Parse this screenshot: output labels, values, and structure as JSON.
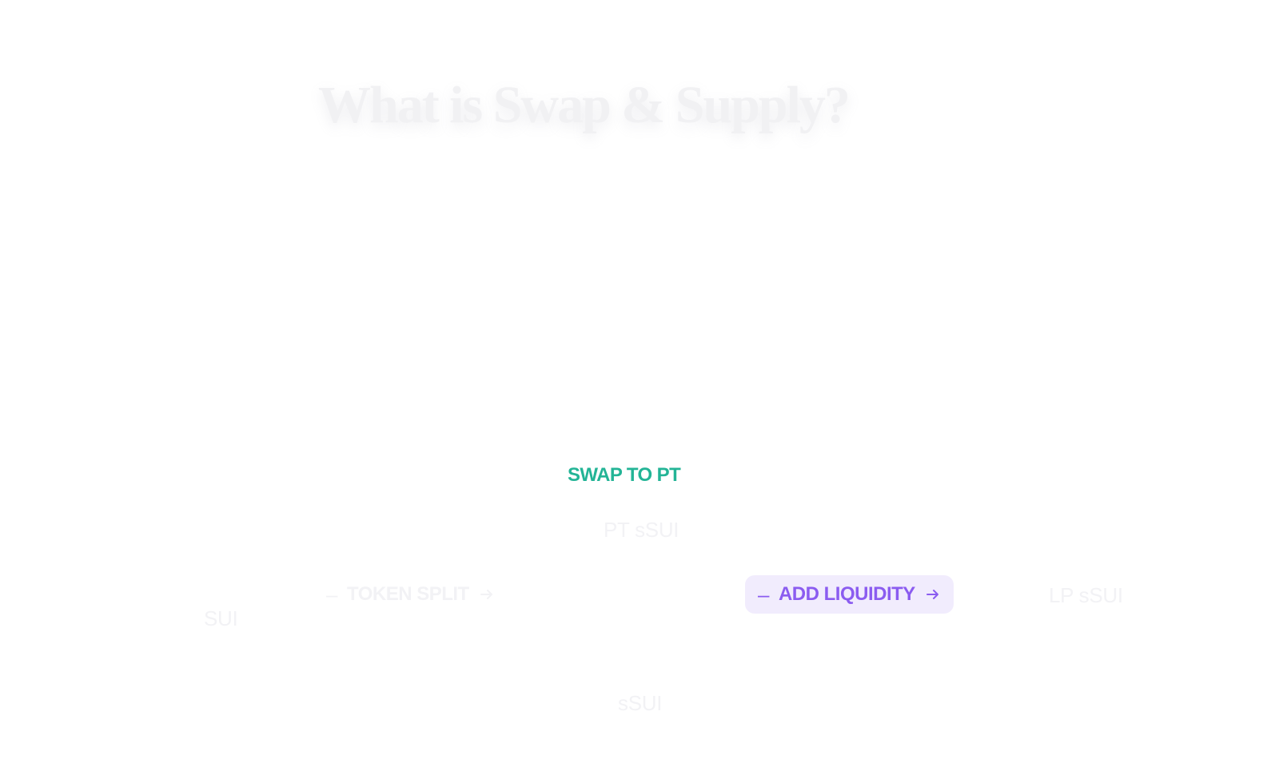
{
  "section": {
    "title": "What is Swap & Supply?",
    "paragraphs": [
      "",
      "",
      "",
      ""
    ]
  },
  "diagram": {
    "top_step_label": "SWAP TO PT",
    "pt_token": "PT sSUI",
    "deposit_label": "",
    "start_token": "SUI",
    "split_step_label": "TOKEN SPLIT",
    "add_step_label": "ADD LIQUIDITY",
    "end_token": "LP sSUI",
    "bottom_label": "",
    "bottom_token": "sSUI"
  },
  "colors": {
    "swap_label": "#23b496",
    "add_liquidity_text": "#8b5cf0",
    "add_liquidity_bg": "#f1ecfd",
    "faded_text": "#f2f2f5"
  },
  "icons": {
    "dash": "minus-icon",
    "arrow": "arrow-right-icon"
  }
}
